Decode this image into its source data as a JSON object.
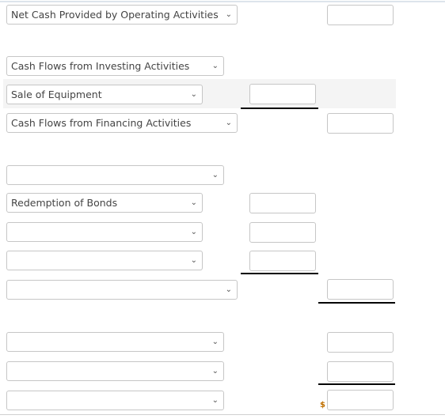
{
  "rows": [
    {
      "select": "Net Cash Provided by Operating Activities",
      "amount": ""
    },
    {
      "select": "Cash Flows from Investing Activities"
    },
    {
      "select": "Sale of Equipment",
      "amount": ""
    },
    {
      "select": "Cash Flows from Financing Activities",
      "amount": ""
    },
    {
      "select": ""
    },
    {
      "select": "Redemption of Bonds",
      "amount": ""
    },
    {
      "select": "",
      "amount": ""
    },
    {
      "select": "",
      "amount": ""
    },
    {
      "select": "",
      "amount": ""
    },
    {
      "select": "",
      "amount": ""
    },
    {
      "select": "",
      "amount": ""
    },
    {
      "select": "",
      "amount": ""
    }
  ],
  "currency_symbol": "$",
  "icons": {
    "dropdown": "chevron-down-icon"
  }
}
